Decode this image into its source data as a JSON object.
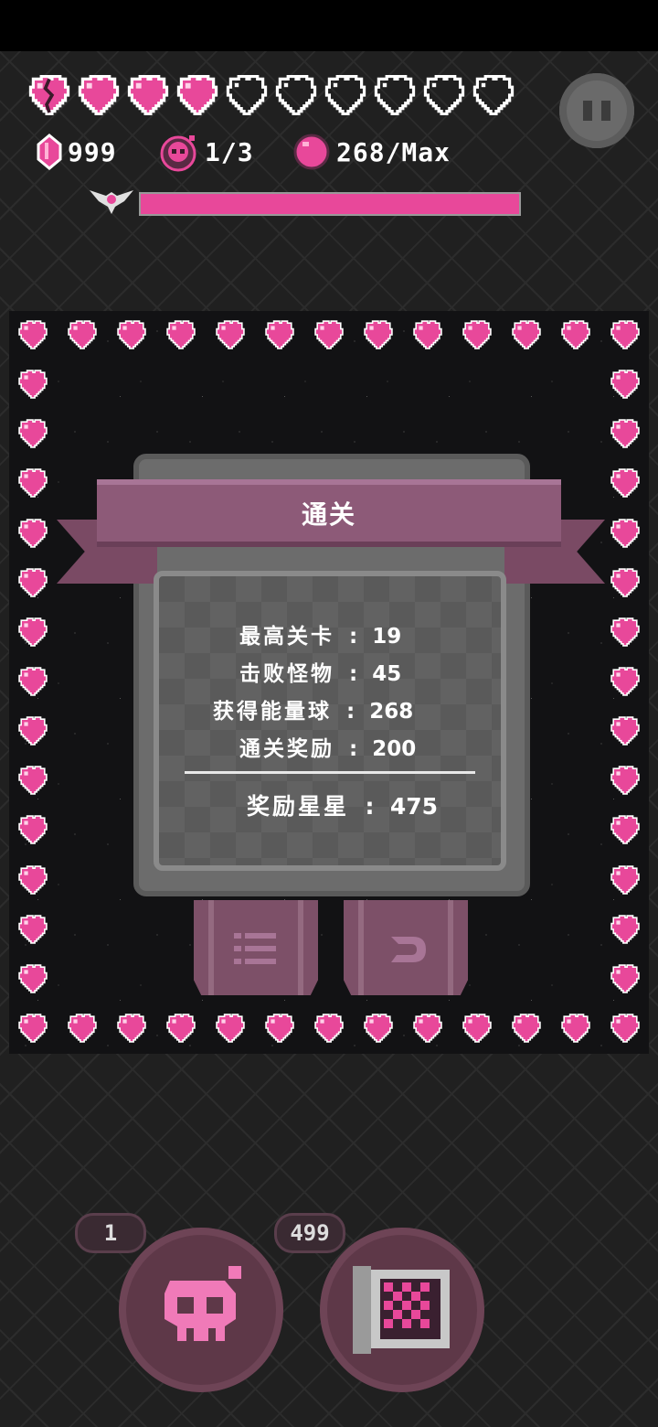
{
  "hud": {
    "hearts": [
      "broken",
      "full",
      "full",
      "full",
      "empty",
      "empty",
      "empty",
      "empty",
      "empty",
      "empty"
    ],
    "gems": "999",
    "bombs": "1/3",
    "orbs": "268/Max",
    "xp_fraction": 1.0
  },
  "result": {
    "title": "通关",
    "stats": [
      {
        "label": "最高关卡",
        "value": "19"
      },
      {
        "label": "击败怪物",
        "value": "45"
      },
      {
        "label": "获得能量球",
        "value": "268"
      },
      {
        "label": "通关奖励",
        "value": "200"
      }
    ],
    "total": {
      "label": "奖励星星",
      "value": "475"
    }
  },
  "bottom": {
    "skull_count": "1",
    "map_count": "499"
  },
  "colors": {
    "accent_pink": "#e8489a",
    "ribbon": "#8d5a78",
    "panel": "#6c6c6c",
    "button": "#7d5068"
  }
}
